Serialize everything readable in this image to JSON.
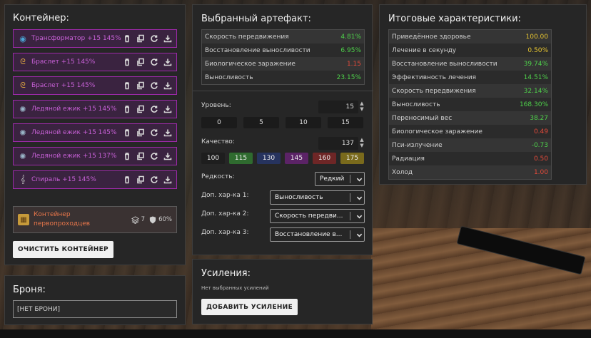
{
  "container": {
    "title": "Контейнер:",
    "slots": [
      {
        "label": "Трансформатор +15 145%",
        "icon": "transformer-icon",
        "icon_color": "#4aa6d6"
      },
      {
        "label": "Браслет +15 145%",
        "icon": "bracelet-icon",
        "icon_color": "#d6a040"
      },
      {
        "label": "Браслет +15 145%",
        "icon": "bracelet-icon",
        "icon_color": "#d6a040"
      },
      {
        "label": "Ледяной ежик +15 145%",
        "icon": "ice-hedgehog-icon",
        "icon_color": "#9ab6c8"
      },
      {
        "label": "Ледяной ежик +15 145%",
        "icon": "ice-hedgehog-icon",
        "icon_color": "#9ab6c8"
      },
      {
        "label": "Ледяной ежик +15 137%",
        "icon": "ice-hedgehog-icon",
        "icon_color": "#9ab6c8"
      },
      {
        "label": "Спираль +15 145%",
        "icon": "spiral-icon",
        "icon_color": "#c8c8c8"
      }
    ],
    "card": {
      "name_line1": "Контейнер",
      "name_line2": "первопроходцев",
      "capacity": "7",
      "protection": "60%"
    },
    "clear_label": "ОЧИСТИТЬ КОНТЕЙНЕР"
  },
  "armor": {
    "title": "Броня:",
    "value": "[НЕТ БРОНИ]"
  },
  "artifact": {
    "title": "Выбранный артефакт:",
    "stats": [
      {
        "name": "Скорость передвижения",
        "value": "4.81%",
        "color": "green"
      },
      {
        "name": "Восстановление выносливости",
        "value": "6.95%",
        "color": "green"
      },
      {
        "name": "Биологическое заражение",
        "value": "1.15",
        "color": "red"
      },
      {
        "name": "Выносливость",
        "value": "23.15%",
        "color": "green"
      }
    ],
    "level_label": "Уровень:",
    "level_value": "15",
    "level_presets": [
      "0",
      "5",
      "10",
      "15"
    ],
    "quality_label": "Качество:",
    "quality_value": "137",
    "quality_presets": [
      {
        "label": "100",
        "color": "#1e1e1e"
      },
      {
        "label": "115",
        "color": "#2f6b2f"
      },
      {
        "label": "130",
        "color": "#26335e"
      },
      {
        "label": "145",
        "color": "#5b2366"
      },
      {
        "label": "160",
        "color": "#6e2626"
      },
      {
        "label": "175",
        "color": "#7a6a1c"
      }
    ],
    "rarity_label": "Редкость:",
    "rarity_value": "Редкий",
    "extra1_label": "Доп. хар-ка 1:",
    "extra1_value": "Выносливость",
    "extra2_label": "Доп. хар-ка 2:",
    "extra2_value": "Скорость передви...",
    "extra3_label": "Доп. хар-ка 3:",
    "extra3_value": "Восстановление в..."
  },
  "boosts": {
    "title": "Усиления:",
    "note": "Нет выбранных усилений",
    "add_label": "ДОБАВИТЬ УСИЛЕНИЕ"
  },
  "totals": {
    "title": "Итоговые характеристики:",
    "stats": [
      {
        "name": "Приведённое здоровье",
        "value": "100.00",
        "color": "yellow"
      },
      {
        "name": "Лечение в секунду",
        "value": "0.50%",
        "color": "yellow"
      },
      {
        "name": "Восстановление выносливости",
        "value": "39.74%",
        "color": "green"
      },
      {
        "name": "Эффективность лечения",
        "value": "14.51%",
        "color": "green"
      },
      {
        "name": "Скорость передвижения",
        "value": "32.14%",
        "color": "green"
      },
      {
        "name": "Выносливость",
        "value": "168.30%",
        "color": "green"
      },
      {
        "name": "Переносимый вес",
        "value": "38.27",
        "color": "green"
      },
      {
        "name": "Биологическое заражение",
        "value": "0.49",
        "color": "red"
      },
      {
        "name": "Пси-излучение",
        "value": "-0.73",
        "color": "green"
      },
      {
        "name": "Радиация",
        "value": "0.50",
        "color": "red"
      },
      {
        "name": "Холод",
        "value": "1.00",
        "color": "red"
      }
    ]
  }
}
